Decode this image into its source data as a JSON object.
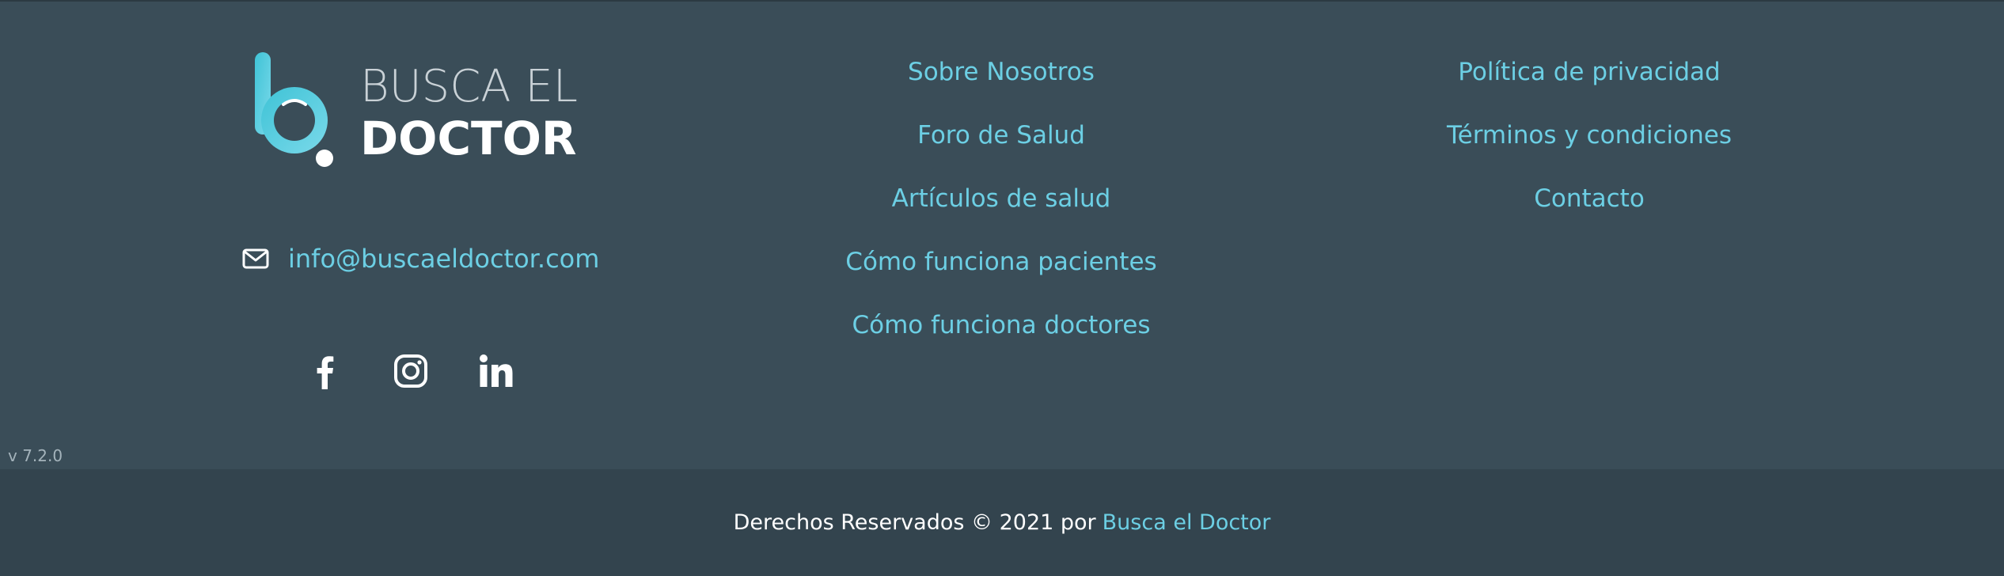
{
  "logo": {
    "line1": "BUSCA EL",
    "line2": "DOCTOR"
  },
  "contact": {
    "email": "info@buscaeldoctor.com",
    "icon": "envelope-icon"
  },
  "social": [
    "facebook-icon",
    "instagram-icon",
    "linkedin-icon"
  ],
  "links_column_1": [
    "Sobre Nosotros",
    "Foro de Salud",
    "Artículos de salud",
    "Cómo funciona pacientes",
    "Cómo funciona doctores"
  ],
  "links_column_2": [
    "Política de privacidad",
    "Términos y condiciones",
    "Contacto"
  ],
  "version": "v 7.2.0",
  "copyright": {
    "text": "Derechos Reservados © 2021 por",
    "link": "Busca el Doctor"
  },
  "colors": {
    "background": "#3a4d58",
    "bottom_bar": "#33444e",
    "accent": "#6ccfe4"
  }
}
